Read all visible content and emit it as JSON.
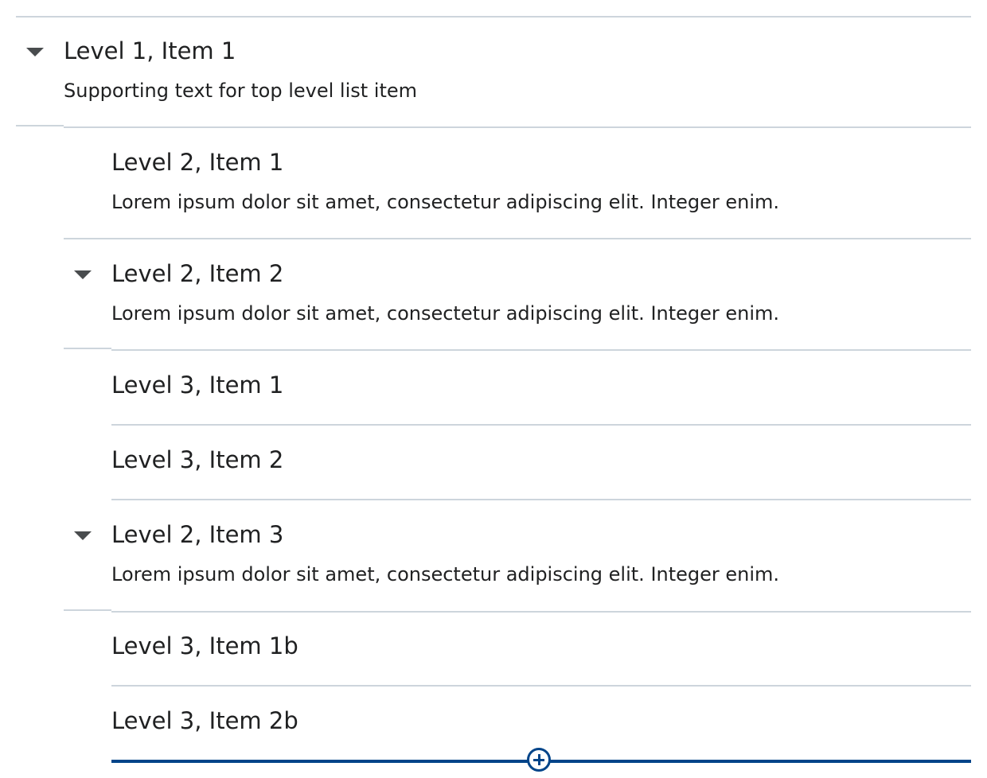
{
  "list": {
    "items": [
      {
        "id": "level1-item1",
        "title": "Level 1, Item 1",
        "supporting_text": "Supporting text for top level list item",
        "level": 1,
        "expanded": true
      },
      {
        "id": "level2-item1",
        "title": "Level 2, Item 1",
        "supporting_text": "Lorem ipsum dolor sit amet, consectetur adipiscing elit. Integer enim.",
        "level": 2,
        "expanded": false
      },
      {
        "id": "level2-item2",
        "title": "Level 2, Item 2",
        "supporting_text": "Lorem ipsum dolor sit amet, consectetur adipiscing elit. Integer enim.",
        "level": 2,
        "expanded": true
      },
      {
        "id": "level3-item1",
        "title": "Level 3, Item 1",
        "level": 3
      },
      {
        "id": "level3-item2",
        "title": "Level 3, Item 2",
        "level": 3
      },
      {
        "id": "level2-item3",
        "title": "Level 2, Item 3",
        "supporting_text": "Lorem ipsum dolor sit amet, consectetur adipiscing elit. Integer enim.",
        "level": 2,
        "expanded": true
      },
      {
        "id": "level3-item1b",
        "title": "Level 3, Item 1b",
        "level": 3
      },
      {
        "id": "level3-item2b",
        "title": "Level 3, Item 2b",
        "level": 3
      }
    ]
  },
  "icons": {
    "expand": "caret-down-icon",
    "add": "add-circle-icon"
  },
  "colors": {
    "divider": "#cdd5dc",
    "accent": "#004489",
    "text": "#202122",
    "caret": "#494c4e"
  }
}
